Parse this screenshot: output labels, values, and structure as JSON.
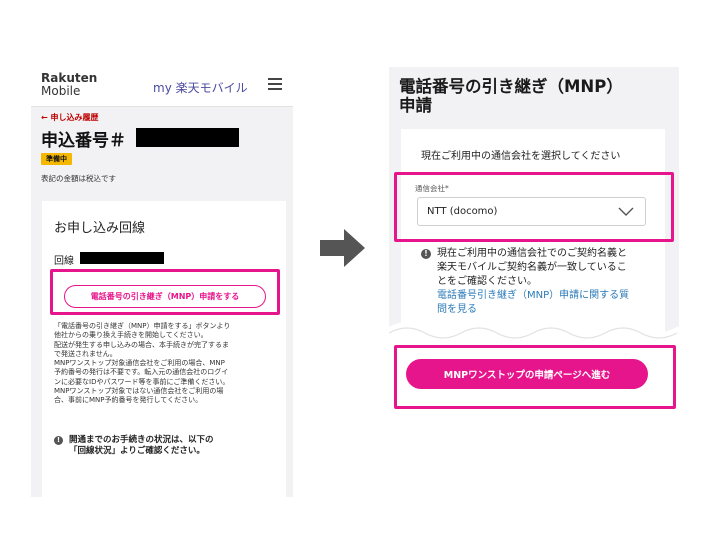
{
  "left_screen": {
    "logo": {
      "line1": "Rakuten",
      "line2": "Mobile"
    },
    "brand": "my 楽天モバイル",
    "back_link": "← 申し込み履歴",
    "order_number_label": "申込番号＃",
    "status_badge": "準備中",
    "tax_note": "表記の金額は税込です",
    "card": {
      "title": "お申し込み回線",
      "line_label": "回線",
      "mnp_button": "電話番号の引き継ぎ（MNP）申請をする",
      "notes": [
        "「電話番号の引き継ぎ（MNP）申請をする」ボタンより",
        "他社からの乗り換え手続きを開始してください。",
        "配送が発生する申し込みの場合、本手続きが完了するま",
        "で発送されません。",
        "MNPワンストップ対象通信会社をご利用の場合、MNP",
        "予約番号の発行は不要です。転入元の通信会社のログイ",
        "ンに必要なIDやパスワード等を事前にご準備ください。",
        "MNPワンストップ対象ではない通信会社をご利用の場",
        "合、事前にMNP予約番号を発行してください。"
      ],
      "info": [
        "開通までのお手続きの状況は、以下の",
        "「回線状況」よりご確認ください。"
      ]
    }
  },
  "right_screen": {
    "title_lines": [
      "電話番号の引き継ぎ（MNP）",
      "申請"
    ],
    "prompt": "現在ご利用中の通信会社を選択してください",
    "carrier_field": {
      "label": "通信会社*",
      "value": "NTT (docomo)"
    },
    "info_lines": [
      "現在ご利用中の通信会社でのご契約名義と",
      "楽天モバイルご契約名義が一致しているこ",
      "とをご確認ください。"
    ],
    "info_link_lines": [
      "電話番号引き継ぎ（MNP）申請に関する質",
      "問を見る"
    ],
    "proceed_button": "MNPワンストップの申請ページへ進む"
  },
  "icons": {
    "menu": "hamburger-menu-icon",
    "info": "info-icon",
    "chevron": "chevron-down-icon",
    "arrow": "right-arrow-icon"
  },
  "colors": {
    "accent": "#e7158c",
    "status": "#f5b800",
    "back_link": "#bf0000",
    "link": "#2a7ab8"
  }
}
